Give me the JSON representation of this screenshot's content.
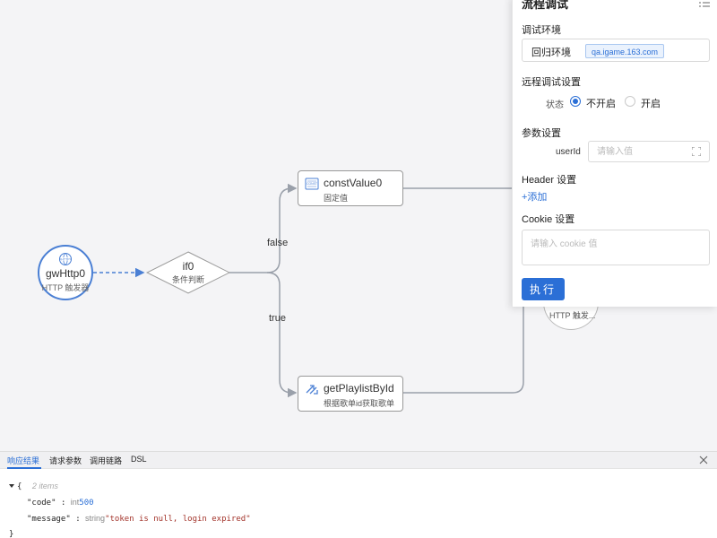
{
  "canvas": {
    "nodes": {
      "trigger": {
        "title": "gwHttp0",
        "subtitle": "HTTP 触发器",
        "icon": "http-icon"
      },
      "condition": {
        "title": "if0",
        "subtitle": "条件判断"
      },
      "const_value": {
        "title": "constValue0",
        "subtitle": "固定值",
        "icon": "const-icon"
      },
      "playlist": {
        "title": "getPlaylistById",
        "subtitle": "根据歌单id获取歌单",
        "icon": "api-icon"
      },
      "end": {
        "subtitle": "HTTP 触发..."
      }
    },
    "edges": {
      "false_label": "false",
      "true_label": "true"
    },
    "colors": {
      "trigger_border": "#4a7fd4",
      "edge": "#9aa0aa",
      "dashed_edge": "#4a7fd4"
    }
  },
  "panel": {
    "title": "流程调试",
    "env_section": "调试环境",
    "env_name": "回归环境",
    "env_host": "qa.igame.163.com",
    "remote_section": "远程调试设置",
    "state_label": "状态",
    "state_options": [
      "不开启",
      "开启"
    ],
    "state_selected": "不开启",
    "params_section": "参数设置",
    "param_name": "userId",
    "param_placeholder": "请输入值",
    "header_section": "Header 设置",
    "add_label": "+添加",
    "cookie_section": "Cookie 设置",
    "cookie_placeholder": "请输入 cookie 值",
    "run_label": "执行",
    "accent": "#2b6fd6"
  },
  "bottom": {
    "tabs": [
      "响应结果",
      "请求参数",
      "调用链路",
      "DSL"
    ],
    "active_tab": "响应结果",
    "json": {
      "open": "{",
      "meta": "2 items",
      "entries": [
        {
          "key": "\"code\"",
          "type": "int",
          "value": "500"
        },
        {
          "key": "\"message\"",
          "type": "string",
          "value": "\"token is null, login expired\""
        }
      ],
      "close": "}"
    }
  }
}
